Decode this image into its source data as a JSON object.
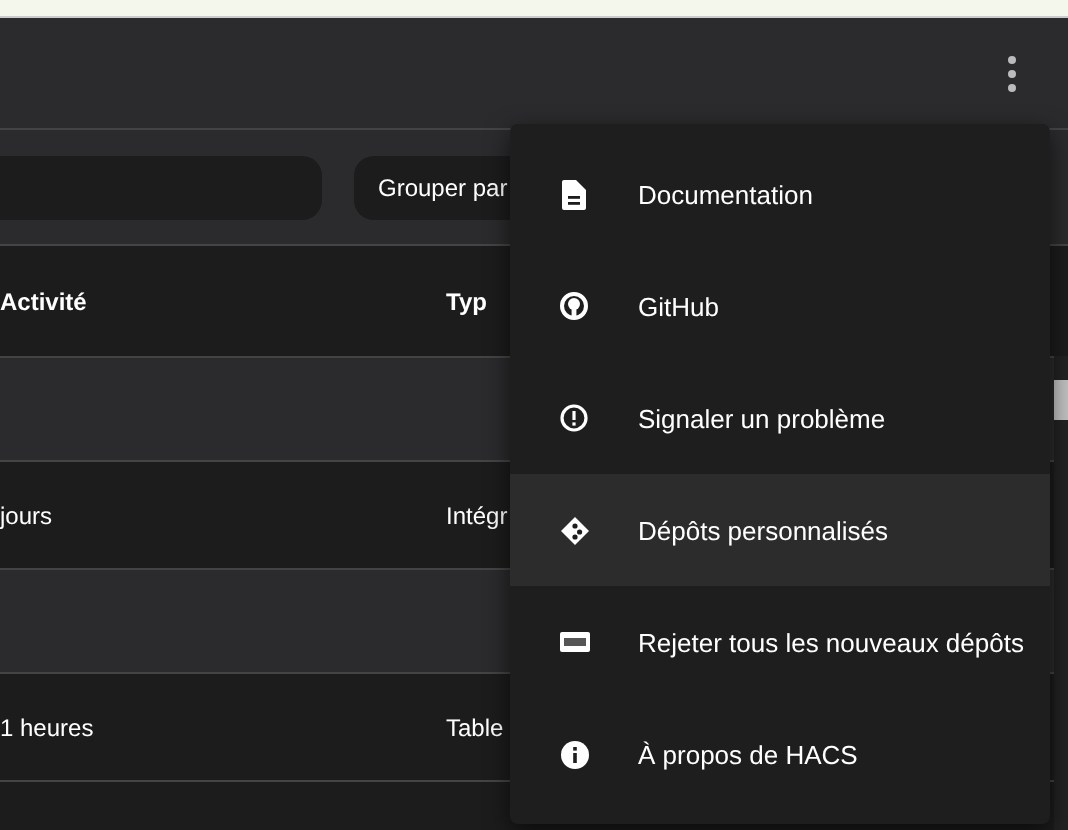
{
  "toolbar": {
    "group_by": "Grouper par"
  },
  "table": {
    "columns": [
      "Activité",
      "Typ"
    ],
    "rows": [
      {
        "kind": "group"
      },
      {
        "kind": "item",
        "activity": "jours",
        "type": "Intégr"
      },
      {
        "kind": "group"
      },
      {
        "kind": "item",
        "activity": "1 heures",
        "type": "Table"
      },
      {
        "kind": "blank"
      }
    ]
  },
  "menu": {
    "items": [
      {
        "label": "Documentation",
        "selected": false
      },
      {
        "label": "GitHub",
        "selected": false
      },
      {
        "label": "Signaler un problème",
        "selected": false
      },
      {
        "label": "Dépôts personnalisés",
        "selected": true
      },
      {
        "label": "Rejeter tous les nouveaux dépôts",
        "selected": false
      },
      {
        "label": "À propos de HACS",
        "selected": false
      }
    ]
  }
}
